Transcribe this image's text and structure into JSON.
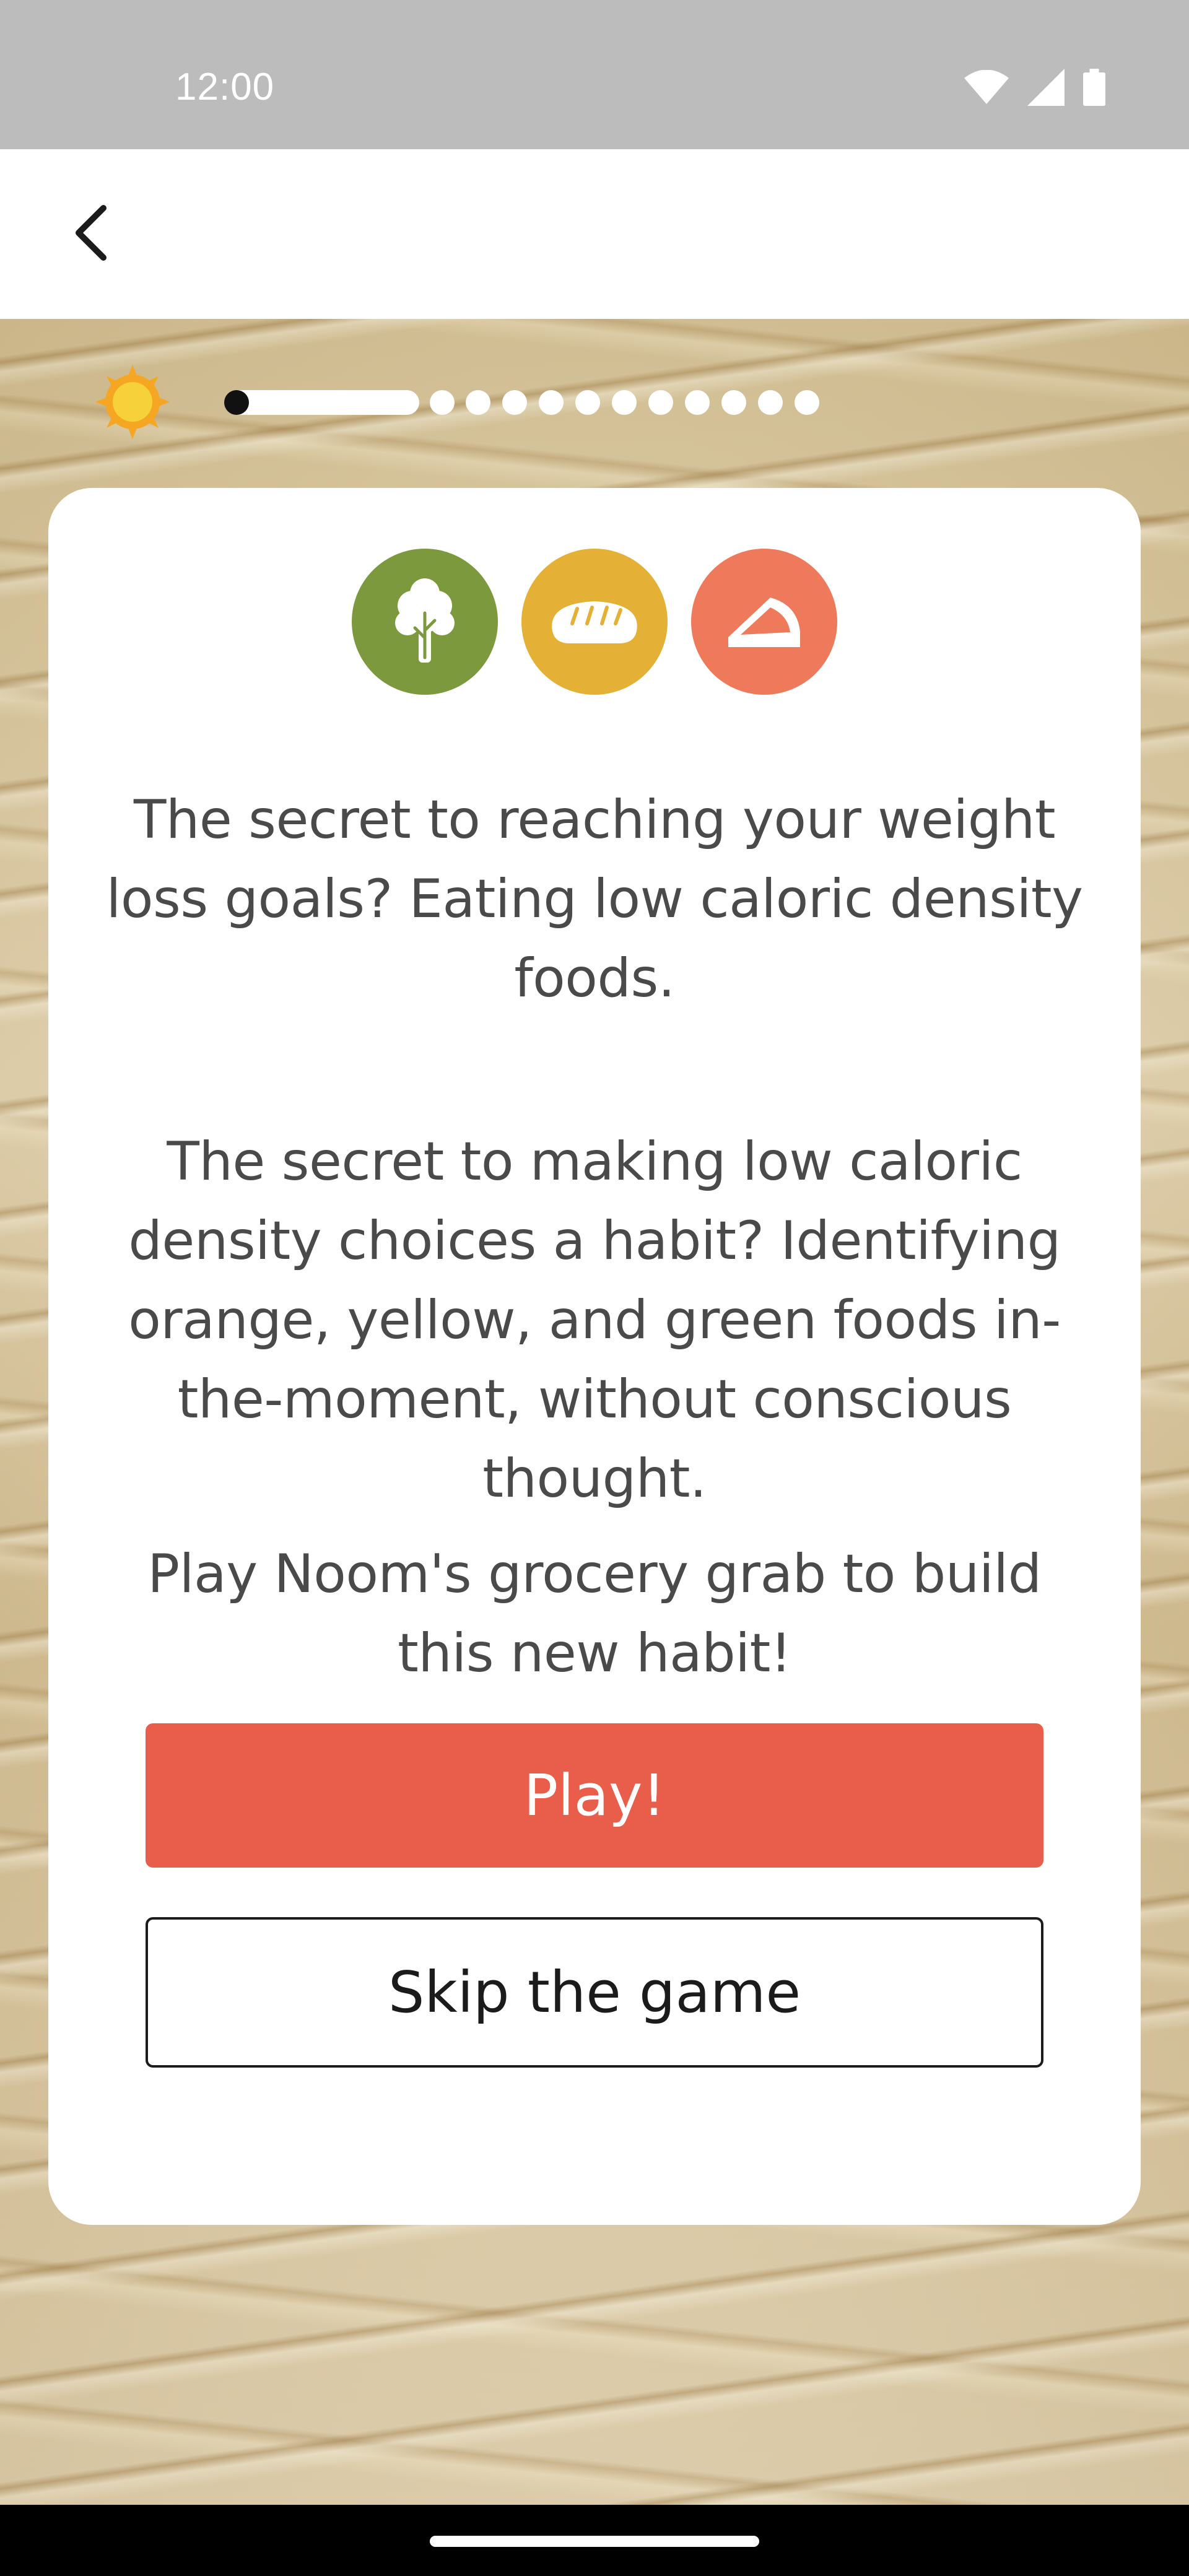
{
  "status_bar": {
    "time": "12:00",
    "icons": [
      "wifi-icon",
      "cellular-signal-icon",
      "battery-icon"
    ]
  },
  "app_bar": {
    "back_icon": "chevron-left-icon"
  },
  "progress": {
    "current_step": 1,
    "total_steps": 12,
    "indicator_icon": "sun-icon"
  },
  "card": {
    "category_icons": [
      {
        "name": "broccoli-icon",
        "color": "#7c9a3d"
      },
      {
        "name": "bread-icon",
        "color": "#e4b035"
      },
      {
        "name": "cake-slice-icon",
        "color": "#ef7a5b"
      }
    ],
    "paragraph_1": "The secret to reaching your weight loss goals? Eating low caloric density foods.",
    "paragraph_2": "The secret to making low caloric density choices a habit? Identifying orange, yellow, and green foods in-the-moment, without conscious thought.",
    "paragraph_3": "Play Noom's grocery grab to build this new habit!",
    "play_label": "Play!",
    "skip_label": "Skip the game"
  },
  "colors": {
    "accent": "#e85e4a",
    "green": "#7c9a3d",
    "yellow": "#e4b035",
    "orange": "#ef7a5b"
  }
}
